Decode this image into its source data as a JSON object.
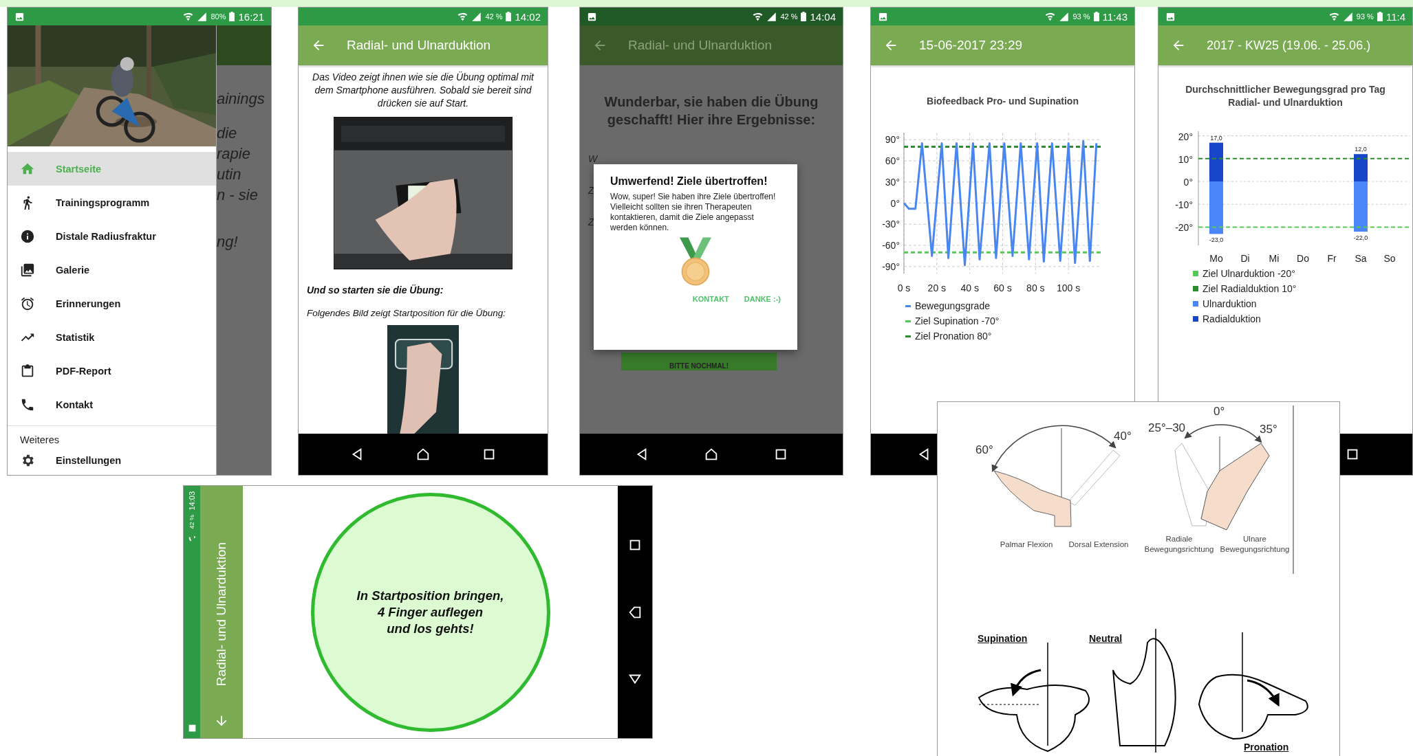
{
  "screens": [
    {
      "kind": "drawer",
      "status": {
        "battery": "80%",
        "time": "16:21"
      },
      "background_lines": [
        "ainings",
        "die",
        "rapie",
        "utin",
        "n - sie",
        "ng!"
      ],
      "menu": [
        {
          "label": "Startseite",
          "selected": true
        },
        {
          "label": "Trainingsprogramm",
          "selected": false
        },
        {
          "label": "Distale Radiusfraktur",
          "selected": false
        },
        {
          "label": "Galerie",
          "selected": false
        },
        {
          "label": "Erinnerungen",
          "selected": false
        },
        {
          "label": "Statistik",
          "selected": false
        },
        {
          "label": "PDF-Report",
          "selected": false
        },
        {
          "label": "Kontakt",
          "selected": false
        }
      ],
      "section": "Weiteres",
      "section_items": [
        {
          "label": "Einstellungen",
          "selected": false
        }
      ]
    },
    {
      "kind": "exercise",
      "status": {
        "battery": "42 %",
        "time": "14:02"
      },
      "title": "Radial- und Ulnarduktion",
      "intro": "Das Video zeigt ihnen wie sie die Übung optimal mit dem Smartphone ausführen. Sobald sie bereit sind drücken sie auf Start.",
      "subheading": "Und so starten sie die Übung:",
      "caption": "Folgendes Bild zeigt Startposition für die Übung:"
    },
    {
      "kind": "dialog",
      "status": {
        "battery": "42 %",
        "time": "14:04"
      },
      "title": "Radial- und Ulnarduktion",
      "heading": "Wunderbar, sie haben die Übung geschafft! Hier ihre Ergebnisse:",
      "peek_lines": [
        "W",
        "Z",
        "Z"
      ],
      "retry_button": "BITTE NOCHMAL!",
      "dialog": {
        "title": "Umwerfend! Ziele übertroffen!",
        "message": "Wow, super! Sie haben ihre Ziele übertroffen! Vielleicht sollten sie ihren Therapeuten kontaktieren, damit die Ziele angepasst werden können.",
        "buttons": [
          "KONTAKT",
          "DANKE :-)"
        ]
      }
    },
    {
      "kind": "chart",
      "status": {
        "battery": "93 %",
        "time": "11:43"
      },
      "title": "15-06-2017 23:29",
      "chart_data": {
        "type": "line",
        "title": "Biofeedback Pro- und Supination",
        "grid": true,
        "legend": true,
        "x": [
          0,
          3,
          7,
          11,
          17,
          23,
          27,
          32,
          37,
          42,
          46,
          52,
          56,
          61,
          66,
          71,
          76,
          81,
          85,
          90,
          95,
          100,
          104,
          109,
          113,
          117
        ],
        "series": [
          {
            "name": "Bewegungsgrade",
            "color": "#4a86f0",
            "values": [
              0,
              -8,
              -8,
              85,
              -75,
              85,
              -78,
              85,
              -88,
              85,
              -80,
              85,
              -78,
              85,
              -75,
              85,
              -80,
              85,
              -83,
              85,
              -82,
              85,
              -85,
              88,
              -82,
              85
            ]
          }
        ],
        "xlim": [
          0,
          120
        ],
        "ylim": [
          -100,
          100
        ],
        "xticks": [
          {
            "value": 0,
            "label": "0 s"
          },
          {
            "value": 20,
            "label": "20 s"
          },
          {
            "value": 40,
            "label": "40 s"
          },
          {
            "value": 60,
            "label": "60 s"
          },
          {
            "value": 80,
            "label": "80 s"
          },
          {
            "value": 100,
            "label": "100 s"
          }
        ],
        "yticks": [
          {
            "value": 90,
            "label": "90°"
          },
          {
            "value": 60,
            "label": "60°"
          },
          {
            "value": 30,
            "label": "30°"
          },
          {
            "value": 0,
            "label": "0°"
          },
          {
            "value": -30,
            "label": "-30°"
          },
          {
            "value": -60,
            "label": "-60°"
          },
          {
            "value": -90,
            "label": "-90°"
          }
        ],
        "ref_lines": [
          {
            "axis": "y",
            "value": -70,
            "label": "Ziel Supination -70°",
            "color": "#55c955"
          },
          {
            "axis": "y",
            "value": 80,
            "label": "Ziel Pronation 80°",
            "color": "#2e8b2e"
          }
        ]
      }
    },
    {
      "kind": "chart",
      "status": {
        "battery": "93 %",
        "time": "11:4"
      },
      "title": "2017 - KW25 (19.06. - 25.06.)",
      "chart_data": {
        "type": "bar",
        "title": "Durchschnittlicher Bewegungsgrad pro Tag Radial- und Ulnarduktion",
        "categories": [
          "Mo",
          "Di",
          "Mi",
          "Do",
          "Fr",
          "Sa",
          "So"
        ],
        "stacked": true,
        "grid": true,
        "legend": true,
        "series": [
          {
            "name": "Ulnarduktion",
            "color": "#4a86f7",
            "values": [
              -23,
              null,
              null,
              null,
              null,
              -22,
              null
            ],
            "value_labels": [
              "-23,0",
              null,
              null,
              null,
              null,
              "-22,0",
              null
            ]
          },
          {
            "name": "Radialduktion",
            "color": "#1747c8",
            "values": [
              17,
              null,
              null,
              null,
              null,
              12,
              null
            ],
            "value_labels": [
              "17,0",
              null,
              null,
              null,
              null,
              "12,0",
              null
            ]
          }
        ],
        "ylim": [
          -28,
          22
        ],
        "yticks": [
          {
            "value": 20,
            "label": "20°"
          },
          {
            "value": 10,
            "label": "10°"
          },
          {
            "value": 0,
            "label": "0°"
          },
          {
            "value": -10,
            "label": "-10°"
          },
          {
            "value": -20,
            "label": "-20°"
          }
        ],
        "ref_lines": [
          {
            "axis": "y",
            "value": -20,
            "label": "Ziel Ulnarduktion -20°",
            "color": "#55c955"
          },
          {
            "axis": "y",
            "value": 10,
            "label": "Ziel Radialduktion 10°",
            "color": "#2e8b2e"
          }
        ]
      }
    }
  ],
  "landscape": {
    "status": {
      "battery": "42 %",
      "time": "14:03"
    },
    "title": "Radial- und Ulnarduktion",
    "prompt_lines": [
      "In Startposition bringen,",
      "4 Finger auflegen",
      "und los gehts!"
    ]
  },
  "illustration": {
    "angle_labels": [
      "60°",
      "40°",
      "25°–30",
      "0°",
      "35°"
    ],
    "captions": [
      "Palmar Flexion",
      "Dorsal Extension",
      "Radiale Bewegungsrichtung",
      "Ulnare Bewegungsrichtung"
    ],
    "rotation_labels": [
      "Supination",
      "Neutral",
      "Pronation"
    ]
  }
}
